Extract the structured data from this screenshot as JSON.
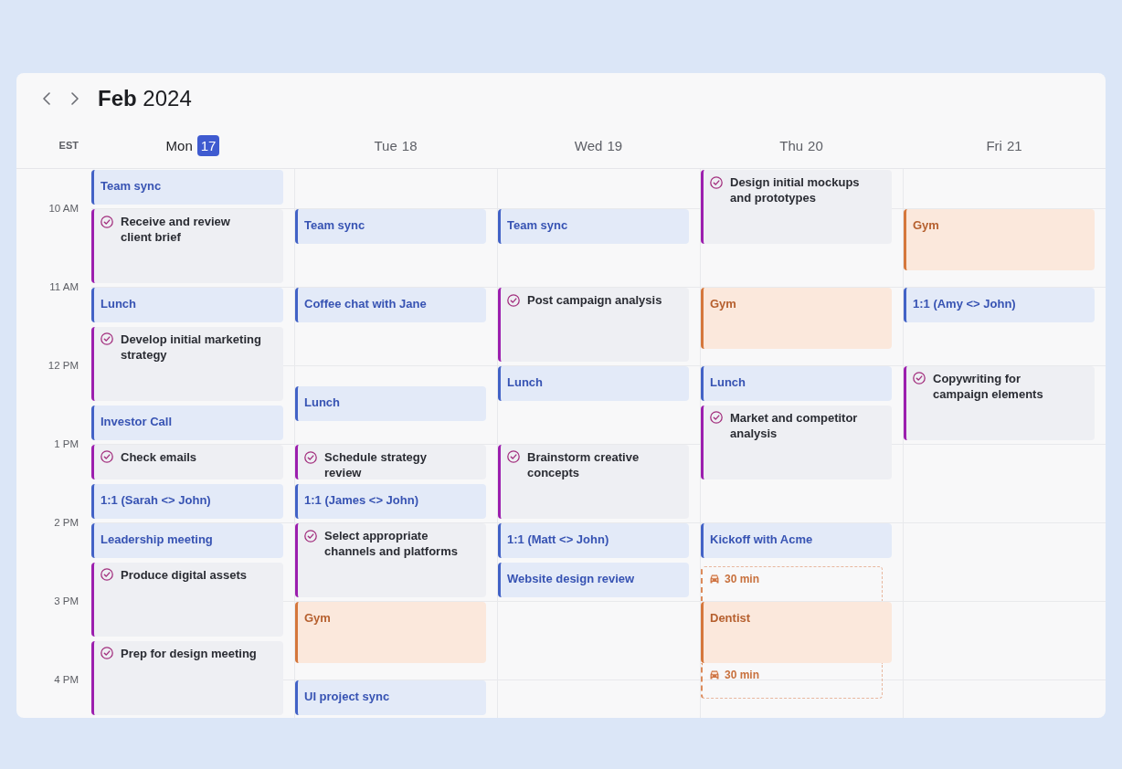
{
  "title": "**Feb** 2024",
  "timezone": "EST",
  "hours": [
    "10 AM",
    "11 AM",
    "12 PM",
    "1 PM",
    "2 PM",
    "3 PM",
    "4 PM"
  ],
  "days": [
    {
      "weekday": "Mon",
      "date": "17",
      "selected": true,
      "events": [
        {
          "kind": "meeting",
          "title": "Team sync"
        },
        {
          "kind": "task",
          "title": "Receive and review client brief"
        },
        {
          "kind": "meeting",
          "title": "Lunch"
        },
        {
          "kind": "task",
          "title": "Develop initial marketing strategy"
        },
        {
          "kind": "meeting",
          "title": "Investor Call"
        },
        {
          "kind": "task",
          "title": "Check emails"
        },
        {
          "kind": "meeting",
          "title": "1:1 (Sarah <> John)"
        },
        {
          "kind": "meeting",
          "title": "Leadership meeting"
        },
        {
          "kind": "task",
          "title": "Produce digital assets"
        },
        {
          "kind": "task",
          "title": "Prep for design meeting"
        }
      ]
    },
    {
      "weekday": "Tue",
      "date": "18",
      "selected": false,
      "events": [
        {
          "kind": "meeting",
          "title": "Team sync"
        },
        {
          "kind": "meeting",
          "title": "Coffee chat with Jane"
        },
        {
          "kind": "meeting",
          "title": "Lunch"
        },
        {
          "kind": "task",
          "title": "Schedule strategy review"
        },
        {
          "kind": "meeting",
          "title": "1:1 (James <> John)"
        },
        {
          "kind": "task",
          "title": "Select appropriate channels and platforms"
        },
        {
          "kind": "personal",
          "title": "Gym"
        },
        {
          "kind": "meeting",
          "title": "UI project sync"
        }
      ]
    },
    {
      "weekday": "Wed",
      "date": "19",
      "selected": false,
      "events": [
        {
          "kind": "meeting",
          "title": "Team sync"
        },
        {
          "kind": "task",
          "title": "Post campaign analysis"
        },
        {
          "kind": "meeting",
          "title": "Lunch"
        },
        {
          "kind": "task",
          "title": "Brainstorm creative concepts"
        },
        {
          "kind": "meeting",
          "title": "1:1 (Matt <> John)"
        },
        {
          "kind": "meeting",
          "title": "Website design review"
        }
      ]
    },
    {
      "weekday": "Thu",
      "date": "20",
      "selected": false,
      "events": [
        {
          "kind": "task",
          "title": "Design initial mockups and prototypes"
        },
        {
          "kind": "personal",
          "title": "Gym"
        },
        {
          "kind": "meeting",
          "title": "Lunch"
        },
        {
          "kind": "task",
          "title": "Market and competitor analysis"
        },
        {
          "kind": "meeting",
          "title": "Kickoff with Acme"
        },
        {
          "kind": "travel",
          "title": "30 min"
        },
        {
          "kind": "personal",
          "title": "Dentist"
        },
        {
          "kind": "travel",
          "title": "30 min"
        }
      ]
    },
    {
      "weekday": "Fri",
      "date": "21",
      "selected": false,
      "events": [
        {
          "kind": "personal",
          "title": "Gym"
        },
        {
          "kind": "meeting",
          "title": "1:1 (Amy <> John)"
        },
        {
          "kind": "task",
          "title": "Copywriting for campaign elements"
        }
      ]
    }
  ]
}
